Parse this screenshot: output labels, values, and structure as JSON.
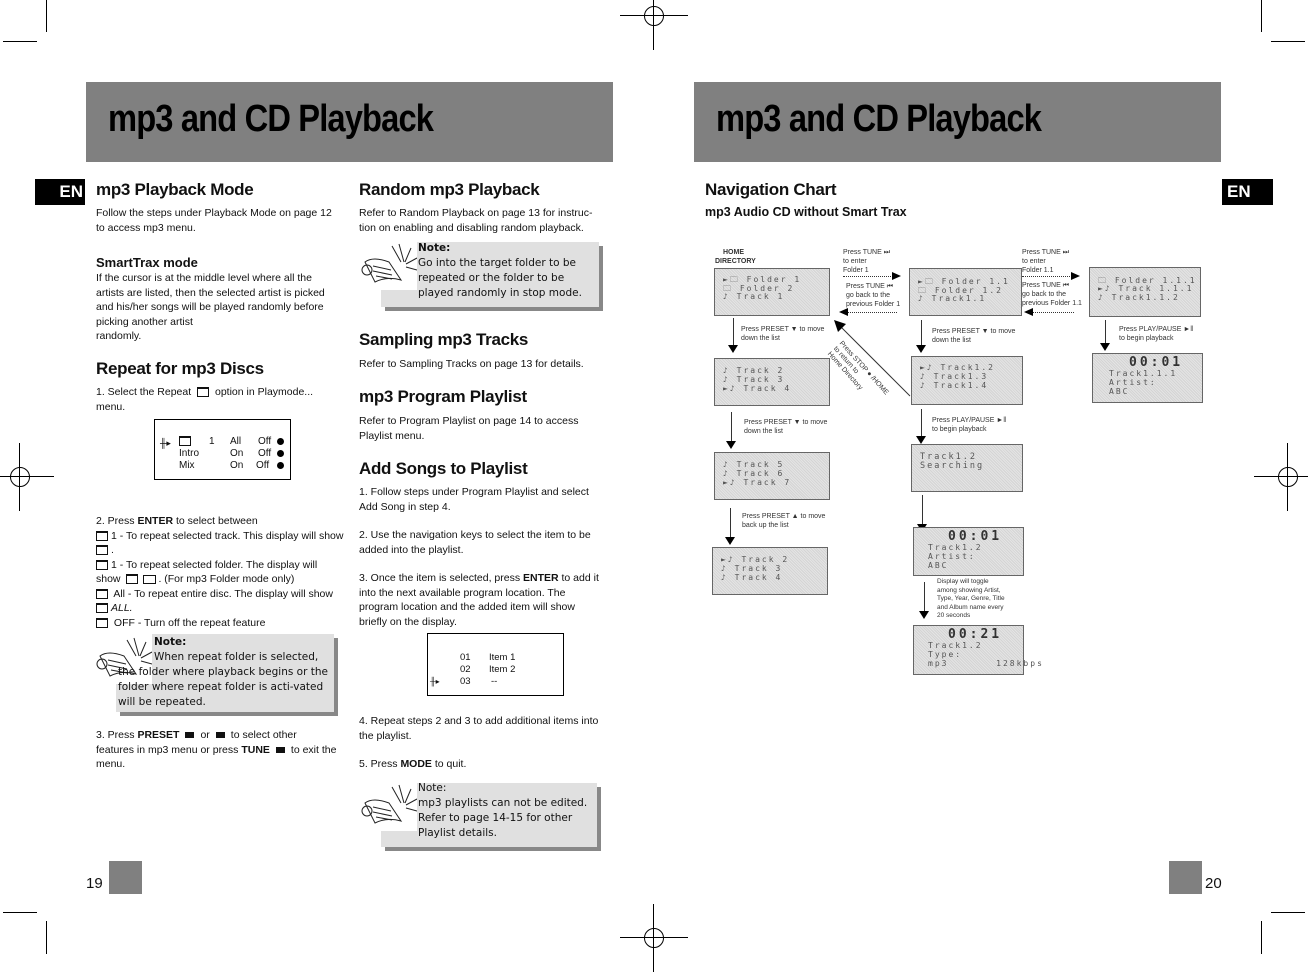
{
  "left_page": {
    "banner_title": "mp3 and CD Playback",
    "lang_tab": "EN",
    "page_number": "19",
    "col1": {
      "playback_mode": {
        "heading": "mp3 Playback Mode",
        "body": "Follow the steps under Playback Mode on page 12 to access mp3 menu."
      },
      "smarttrax": {
        "heading": "SmartTrax mode",
        "body": "If the cursor is at the middle level where all the artists are listed, then the selected artist is picked and his/her songs will be played randomly before picking another artist",
        "body_tail": "randomly."
      },
      "repeat": {
        "heading": "Repeat for mp3 Discs",
        "step1_a": "1. Select the Repeat",
        "step1_b": "option in Playmode... menu.",
        "display": {
          "rows": [
            {
              "label": "",
              "num": "1",
              "mode": "All",
              "state": "Off"
            },
            {
              "label": "Intro",
              "num": "",
              "mode": "On",
              "state": "Off"
            },
            {
              "label": "Mix",
              "num": "",
              "mode": "On",
              "state": "Off"
            }
          ]
        },
        "step2_intro_a": "2. Press ",
        "step2_intro_key": "ENTER",
        "step2_intro_b": " to select between",
        "options": [
          "1 - To repeat selected track. This display will show",
          ".",
          "1 -  To repeat selected folder. The display will",
          "show",
          ". (For mp3 Folder mode only)",
          "All - To repeat entire disc.  The display will show",
          "ALL.",
          "OFF - Turn off the repeat feature"
        ],
        "note": {
          "title": "Note:",
          "text": "When repeat folder is selected, the folder where playback begins or the folder where repeat folder is acti-vated will be repeated."
        },
        "step3_a": "3.  Press ",
        "step3_key1": "PRESET",
        "step3_or": "or",
        "step3_b": "to select other",
        "step3_c": " features in mp3 menu or press ",
        "step3_key2": "TUNE",
        "step3_d": "to exit the menu."
      }
    },
    "col2": {
      "random": {
        "heading": "Random mp3 Playback",
        "body": "Refer to Random Playback on page 13 for instruc-tion on enabling and disabling random playback.",
        "note": {
          "title": "Note:",
          "text": "Go into the target folder to be repeated or the folder to be played randomly in stop mode."
        }
      },
      "sampling": {
        "heading": "Sampling mp3 Tracks",
        "body": "Refer to Sampling Tracks on page 13 for details."
      },
      "program": {
        "heading": "mp3 Program Playlist",
        "body": "Refer to Program Playlist on page 14 to access Playlist menu."
      },
      "add_songs": {
        "heading": "Add Songs to Playlist",
        "step1": "1.  Follow steps under Program Playlist and select Add Song in step  4.",
        "step2": "2.  Use the navigation keys to select the item to be added into the playlist.",
        "step3_a": "3.  Once the item is selected, press ",
        "step3_key": "ENTER",
        "step3_b": " to add it into the next available program location. The program location and the added item will show briefly on the display.",
        "display": {
          "rows": [
            {
              "num": "01",
              "item": "Item 1"
            },
            {
              "num": "02",
              "item": "Item 2"
            },
            {
              "num": "03",
              "item": "--"
            }
          ]
        },
        "step4": "4. Repeat steps 2 and 3 to add additional items into the playlist.",
        "step5_a": "5. Press ",
        "step5_key": "MODE",
        "step5_b": " to quit.",
        "note": {
          "title": "Note:",
          "text": "mp3 playlists can not be edited. Refer to page 14-15 for other Playlist details."
        }
      }
    }
  },
  "right_page": {
    "banner_title": "mp3 and CD Playback",
    "lang_tab": "EN",
    "page_number": "20",
    "heading": "Navigation Chart",
    "subheading": "mp3 Audio CD without Smart Trax",
    "chart": {
      "home_label_1": "HOME",
      "home_label_2": "DIRECTORY",
      "screens": {
        "home": [
          "►🗀 Folder 1",
          "  🗀 Folder 2",
          "  ♪ Track 1"
        ],
        "list_a": [
          "  ♪ Track 2",
          "  ♪ Track 3",
          "►♪ Track 4"
        ],
        "list_b": [
          "  ♪ Track 5",
          "  ♪ Track 6",
          "►♪ Track 7"
        ],
        "list_c": [
          "►♪ Track 2",
          "  ♪ Track 3",
          "  ♪ Track 4"
        ],
        "folder1": [
          "►🗀 Folder 1.1",
          "  🗀 Folder 1.2",
          "  ♪ Track1.1"
        ],
        "folder1_list": [
          "►♪ Track1.2",
          "  ♪ Track1.3",
          "  ♪ Track1.4"
        ],
        "searching": [
          "Track1.2",
          "Searching"
        ],
        "play1": {
          "time": "00:01",
          "lines": [
            "Track1.2",
            "Artist:",
            "ABC"
          ]
        },
        "play2": {
          "time": "00:21",
          "lines": [
            "Track1.2",
            "Type:",
            "mp3       128kbps"
          ]
        },
        "folder11": [
          "  🗀 Folder 1.1.1",
          "►♪ Track 1.1.1",
          "  ♪ Track1.1.2"
        ],
        "play3": {
          "time": "00:01",
          "lines": [
            "Track1.1.1",
            "Artist:",
            "ABC"
          ]
        }
      },
      "captions": {
        "tune_enter_f1": [
          "Press TUNE ⏭",
          "to enter",
          "Folder 1"
        ],
        "tune_back_f1": [
          "Press TUNE ⏮",
          "go back to the",
          "previous Folder 1"
        ],
        "tune_enter_f11": [
          "Press TUNE ⏭",
          "to enter",
          "Folder 1.1"
        ],
        "tune_back_f11": [
          "Press TUNE ⏮",
          "go back to the",
          "previous Folder 1.1"
        ],
        "preset_down_1": [
          "Press PRESET ▼ to move",
          "down the list"
        ],
        "preset_down_2": [
          "Press PRESET ▼ to move",
          "down the list"
        ],
        "preset_down_3": [
          "Press PRESET ▼  to move",
          "down the list"
        ],
        "preset_up": [
          "Press PRESET ▲  to move",
          "back up the list"
        ],
        "play_pause_1": [
          "Press PLAY/PAUSE ►‖",
          "to begin playback"
        ],
        "play_pause_2": [
          "Press PLAY/PAUSE ►‖",
          "to begin playback"
        ],
        "stop_home": [
          "Press STOP ● /HOME",
          "to return to",
          "Home Directory"
        ],
        "toggle": [
          "Display will toggle",
          "among showing Artist,",
          "Type, Year, Genre, Title",
          "and Album name every",
          "20 seconds"
        ]
      }
    }
  }
}
